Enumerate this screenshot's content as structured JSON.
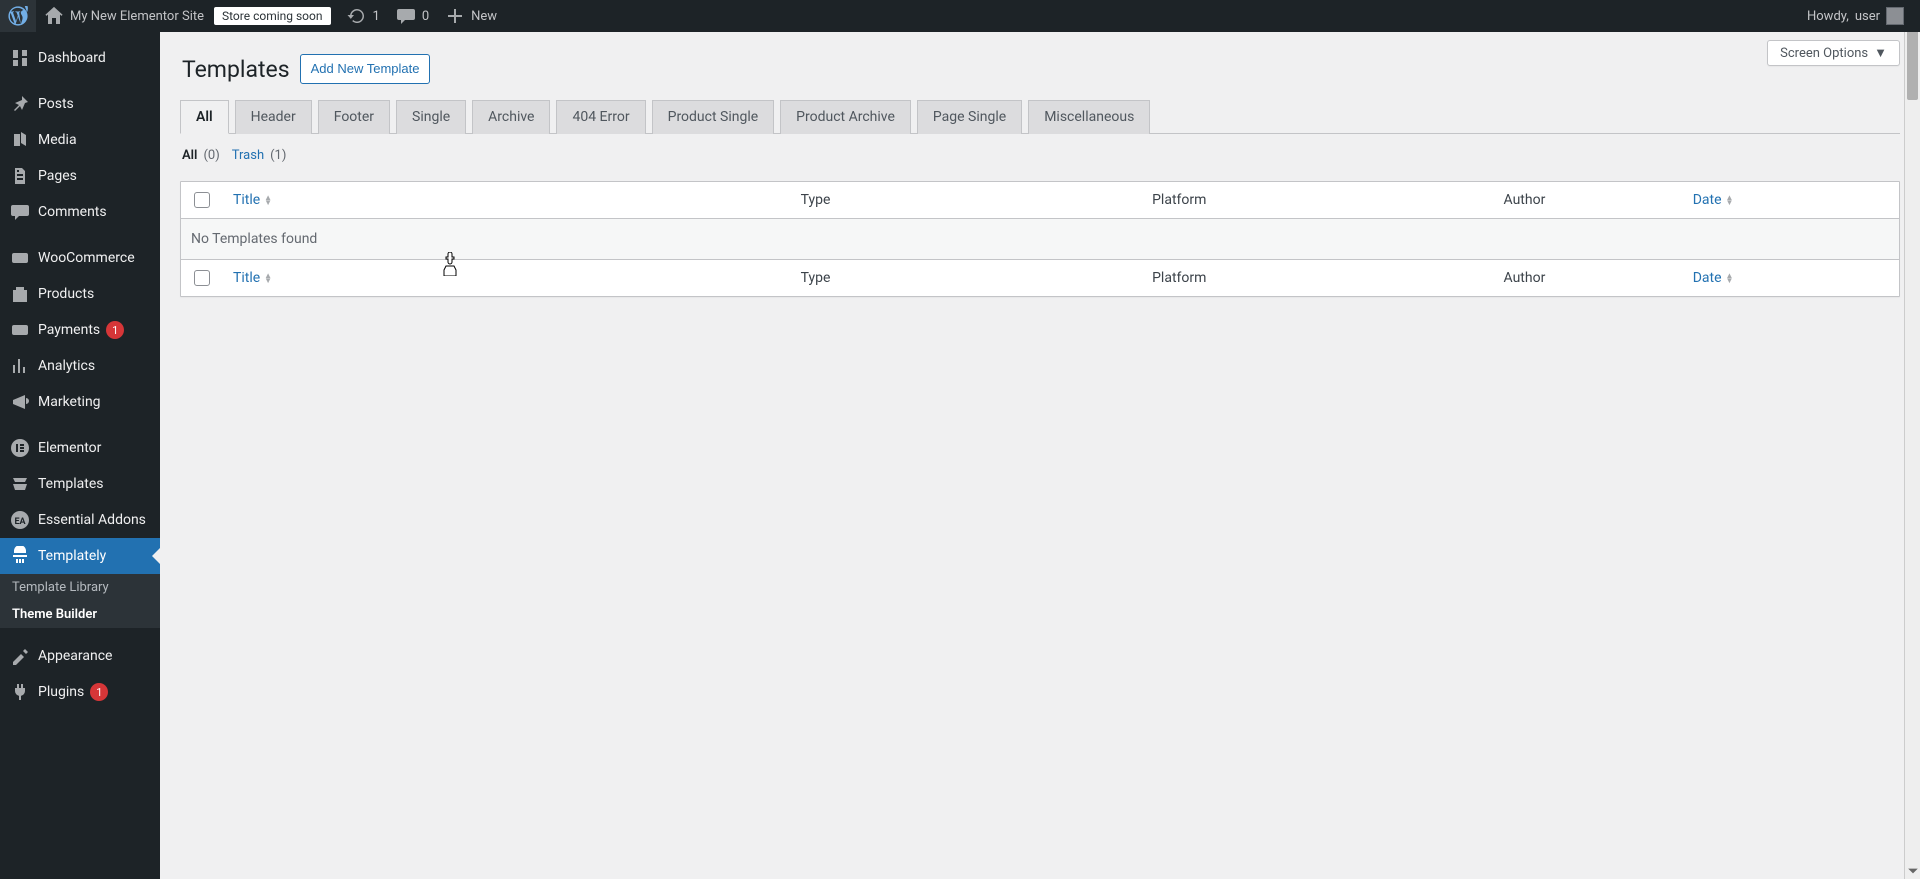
{
  "adminbar": {
    "site_name": "My New Elementor Site",
    "store_label": "Store coming soon",
    "updates_count": "1",
    "comments_count": "0",
    "new_label": "New",
    "howdy_prefix": "Howdy, ",
    "user_name": "user"
  },
  "sidebar": {
    "items": [
      {
        "key": "dashboard",
        "label": "Dashboard"
      },
      {
        "key": "posts",
        "label": "Posts"
      },
      {
        "key": "media",
        "label": "Media"
      },
      {
        "key": "pages",
        "label": "Pages"
      },
      {
        "key": "comments",
        "label": "Comments"
      },
      {
        "key": "woocommerce",
        "label": "WooCommerce"
      },
      {
        "key": "products",
        "label": "Products"
      },
      {
        "key": "payments",
        "label": "Payments",
        "badge": "1"
      },
      {
        "key": "analytics",
        "label": "Analytics"
      },
      {
        "key": "marketing",
        "label": "Marketing"
      },
      {
        "key": "elementor",
        "label": "Elementor"
      },
      {
        "key": "templates",
        "label": "Templates"
      },
      {
        "key": "essential",
        "label": "Essential Addons"
      },
      {
        "key": "templately",
        "label": "Templately"
      },
      {
        "key": "appearance",
        "label": "Appearance"
      },
      {
        "key": "plugins",
        "label": "Plugins",
        "badge": "1"
      }
    ],
    "submenu": {
      "library": "Template Library",
      "theme_builder": "Theme Builder"
    }
  },
  "page": {
    "title": "Templates",
    "add_new": "Add New Template",
    "screen_options": "Screen Options"
  },
  "tabs": {
    "items": [
      {
        "label": "All",
        "active": true
      },
      {
        "label": "Header"
      },
      {
        "label": "Footer"
      },
      {
        "label": "Single"
      },
      {
        "label": "Archive"
      },
      {
        "label": "404 Error"
      },
      {
        "label": "Product Single"
      },
      {
        "label": "Product Archive"
      },
      {
        "label": "Page Single"
      },
      {
        "label": "Miscellaneous"
      }
    ]
  },
  "filters": {
    "all_label": "All",
    "all_count": "(0)",
    "trash_label": "Trash",
    "trash_count": "(1)"
  },
  "table": {
    "cols": {
      "title": "Title",
      "type": "Type",
      "platform": "Platform",
      "author": "Author",
      "date": "Date"
    },
    "empty": "No Templates found"
  }
}
